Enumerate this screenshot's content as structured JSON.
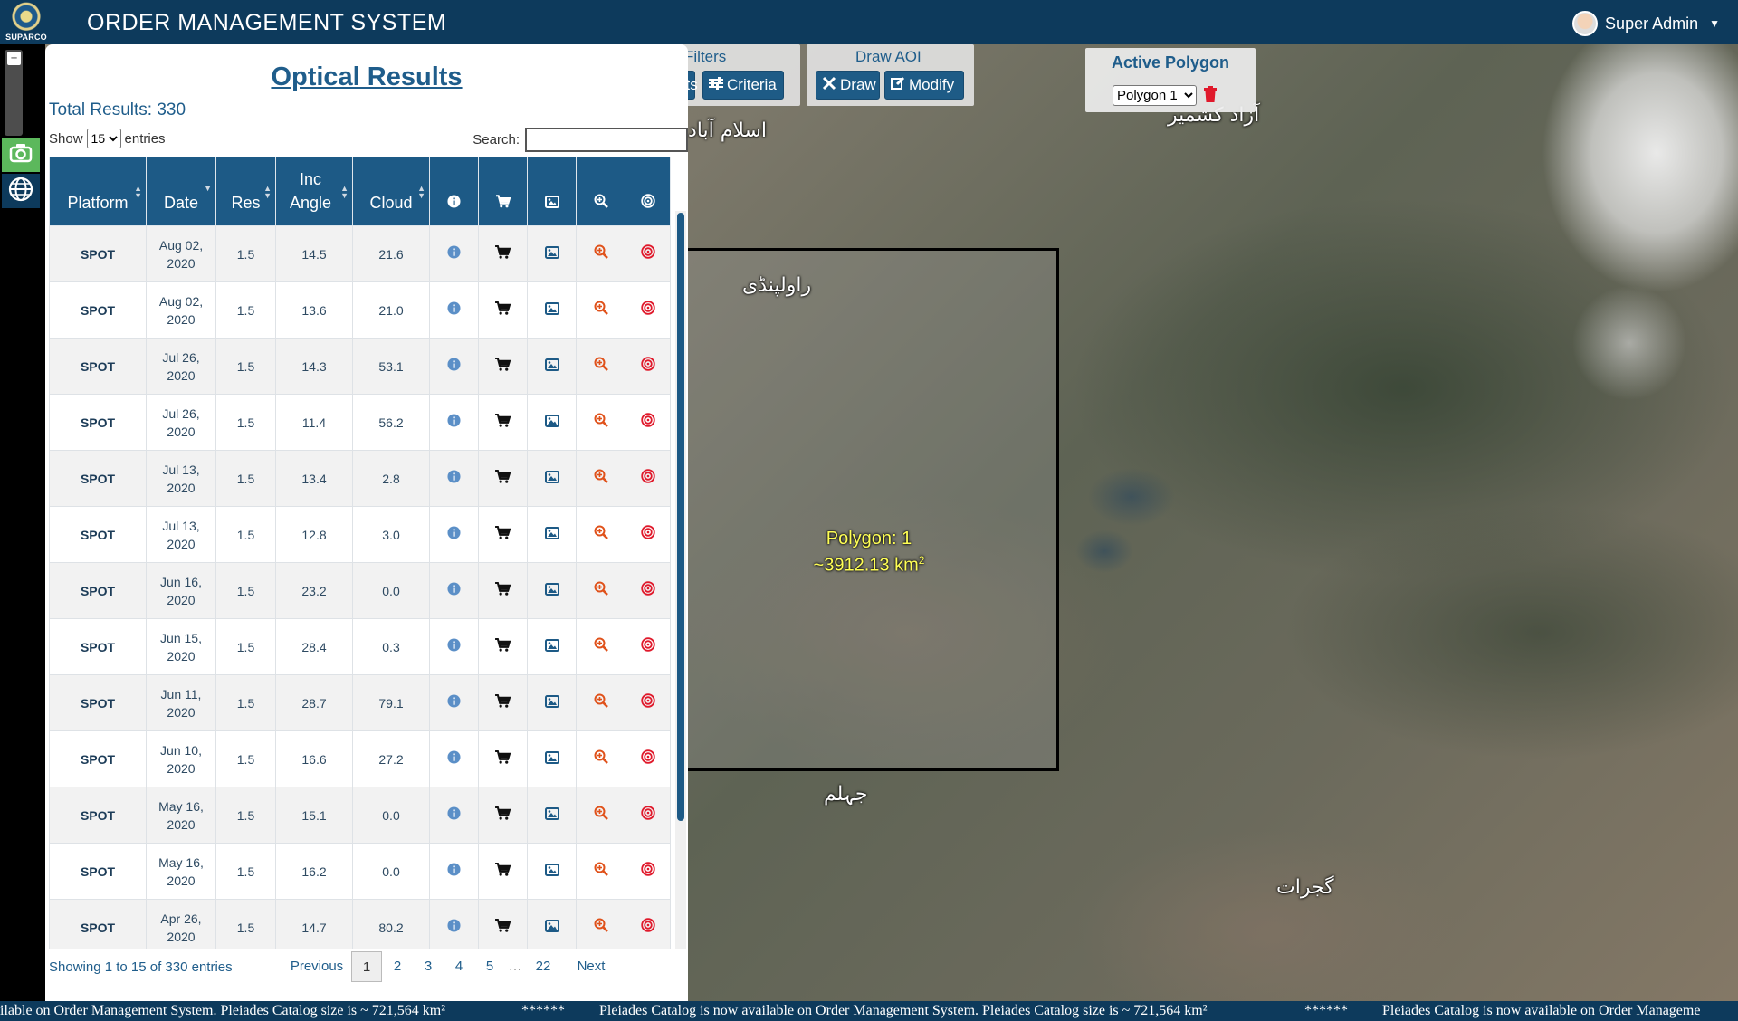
{
  "header": {
    "logo_text": "SUPARCO",
    "title": "ORDER MANAGEMENT SYSTEM",
    "user_name": "Super Admin"
  },
  "map": {
    "labels": [
      "اسلام آباد",
      "آزاد کشمیر",
      "راولپنڈی",
      "جہلم",
      "گجرات"
    ],
    "polygon_label_line1": "Polygon: 1",
    "polygon_label_line2": "~3912.13 km",
    "polygon_label_unit_sup": "2"
  },
  "toolbar": {
    "filters_title": "Filters",
    "products_btn_partial": "cts",
    "criteria_btn": "Criteria",
    "draw_aoi_title": "Draw AOI",
    "draw_btn": "Draw",
    "modify_btn": "Modify"
  },
  "active_polygon": {
    "title": "Active Polygon",
    "selected": "Polygon 1"
  },
  "results": {
    "title": "Optical Results",
    "total": "Total Results: 330",
    "show_label": "Show",
    "entries_label": "entries",
    "page_length": "15",
    "search_label": "Search:",
    "search_value": "",
    "columns": [
      "Platform",
      "Date",
      "Res",
      "Inc Angle",
      "Cloud"
    ],
    "rows": [
      {
        "platform": "SPOT",
        "date": "Aug 02, 2020",
        "res": "1.5",
        "inc": "14.5",
        "cloud": "21.6"
      },
      {
        "platform": "SPOT",
        "date": "Aug 02, 2020",
        "res": "1.5",
        "inc": "13.6",
        "cloud": "21.0"
      },
      {
        "platform": "SPOT",
        "date": "Jul 26, 2020",
        "res": "1.5",
        "inc": "14.3",
        "cloud": "53.1"
      },
      {
        "platform": "SPOT",
        "date": "Jul 26, 2020",
        "res": "1.5",
        "inc": "11.4",
        "cloud": "56.2"
      },
      {
        "platform": "SPOT",
        "date": "Jul 13, 2020",
        "res": "1.5",
        "inc": "13.4",
        "cloud": "2.8"
      },
      {
        "platform": "SPOT",
        "date": "Jul 13, 2020",
        "res": "1.5",
        "inc": "12.8",
        "cloud": "3.0"
      },
      {
        "platform": "SPOT",
        "date": "Jun 16, 2020",
        "res": "1.5",
        "inc": "23.2",
        "cloud": "0.0"
      },
      {
        "platform": "SPOT",
        "date": "Jun 15, 2020",
        "res": "1.5",
        "inc": "28.4",
        "cloud": "0.3"
      },
      {
        "platform": "SPOT",
        "date": "Jun 11, 2020",
        "res": "1.5",
        "inc": "28.7",
        "cloud": "79.1"
      },
      {
        "platform": "SPOT",
        "date": "Jun 10, 2020",
        "res": "1.5",
        "inc": "16.6",
        "cloud": "27.2"
      },
      {
        "platform": "SPOT",
        "date": "May 16, 2020",
        "res": "1.5",
        "inc": "15.1",
        "cloud": "0.0"
      },
      {
        "platform": "SPOT",
        "date": "May 16, 2020",
        "res": "1.5",
        "inc": "16.2",
        "cloud": "0.0"
      },
      {
        "platform": "SPOT",
        "date": "Apr 26, 2020",
        "res": "1.5",
        "inc": "14.7",
        "cloud": "80.2"
      }
    ],
    "info_text": "Showing 1 to 15 of 330 entries",
    "pagination": {
      "previous": "Previous",
      "pages": [
        "1",
        "2",
        "3",
        "4",
        "5",
        "…",
        "22"
      ],
      "current": "1",
      "next": "Next"
    }
  },
  "ticker": {
    "segments": [
      "ilable on Order Management System. Pleiades Catalog size is ~ 721,564 km²",
      "******",
      "Pleiades Catalog is now available on Order Management System. Pleiades Catalog size is ~ 721,564 km²",
      "******",
      "Pleiades Catalog is now available on Order Manageme"
    ]
  },
  "colors": {
    "header_bg": "#0d3a5c",
    "accent": "#1d5a86",
    "camera_btn": "#5cb85c",
    "icon_info": "#5b8fc7",
    "icon_zoom": "#e0521b",
    "icon_target": "#e0192b",
    "trash": "#e0192b",
    "polygon_label": "#ffff55"
  },
  "icons": {
    "column_icons": [
      "info-icon",
      "cart-icon",
      "image-icon",
      "zoom-in-icon",
      "target-icon"
    ]
  }
}
